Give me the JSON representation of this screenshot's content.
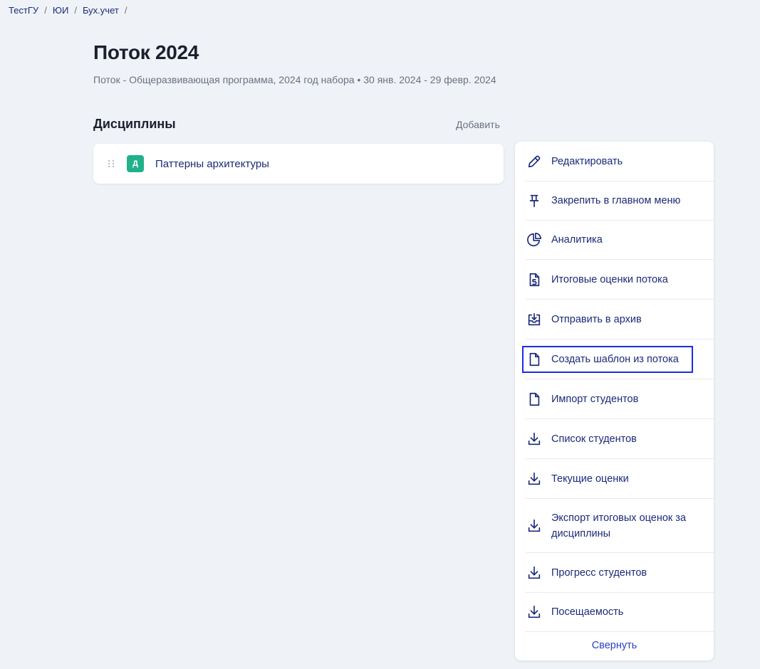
{
  "breadcrumb": {
    "items": [
      "ТестГУ",
      "ЮИ",
      "Бух.учет"
    ],
    "separator": "/"
  },
  "header": {
    "title": "Поток 2024",
    "subtitle": "Поток - Общеразвивающая программа, 2024 год набора • 30 янв. 2024 - 29 февр. 2024"
  },
  "disciplines": {
    "title": "Дисциплины",
    "add_label": "Добавить",
    "items": [
      {
        "badge": "Д",
        "name": "Паттерны архитектуры",
        "badge_color": "#22b08b"
      }
    ]
  },
  "actions": {
    "items": [
      {
        "label": "Редактировать",
        "icon": "pencil-icon"
      },
      {
        "label": "Закрепить в главном меню",
        "icon": "pin-icon"
      },
      {
        "label": "Аналитика",
        "icon": "pie-chart-icon"
      },
      {
        "label": "Итоговые оценки потока",
        "icon": "grade-document-icon"
      },
      {
        "label": "Отправить в архив",
        "icon": "archive-icon"
      },
      {
        "label": "Создать шаблон из потока",
        "icon": "document-icon"
      },
      {
        "label": "Импорт студентов",
        "icon": "document-icon"
      },
      {
        "label": "Список студентов",
        "icon": "download-icon"
      },
      {
        "label": "Текущие оценки",
        "icon": "download-icon"
      },
      {
        "label": "Экспорт итоговых оценок за дисциплины",
        "icon": "download-icon"
      },
      {
        "label": "Прогресс студентов",
        "icon": "download-icon"
      },
      {
        "label": "Посещаемость",
        "icon": "download-icon"
      }
    ],
    "highlighted_item": "Создать шаблон из потока",
    "collapse_label": "Свернуть"
  },
  "colors": {
    "background": "#eff2f6",
    "link": "#1b2a7a",
    "accent": "#2b3fc7",
    "highlight_border": "#1a2ee0"
  }
}
